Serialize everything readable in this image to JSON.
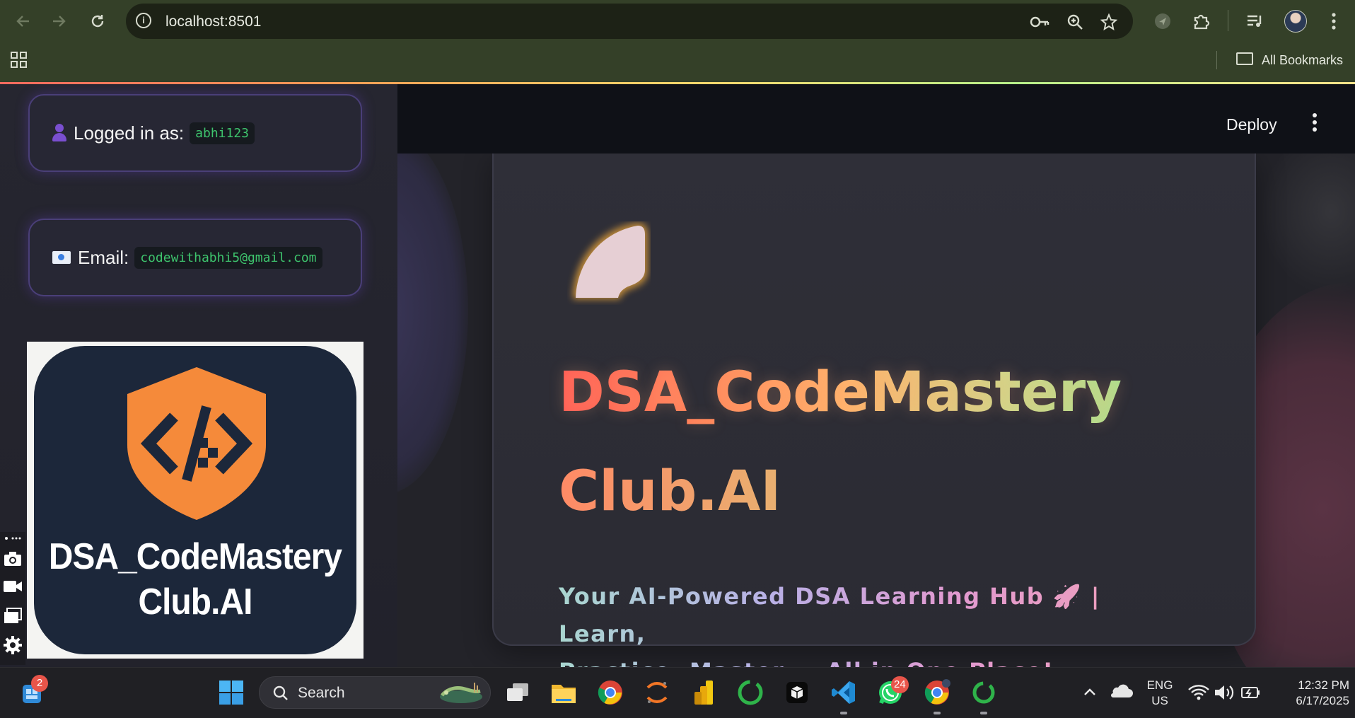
{
  "browser": {
    "url": "localhost:8501",
    "bookmarks_label": "All Bookmarks",
    "accent": "#ff6a5f"
  },
  "sidebar": {
    "logged_in_label": "Logged in as:",
    "username": "abhi123",
    "email_label": "Email:",
    "email": "codewithabhi5@gmail.com",
    "logo_line1": "DSA_CodeMastery",
    "logo_line2": "Club.AI",
    "logo_color": "#f58a3a"
  },
  "header": {
    "deploy_label": "Deploy"
  },
  "hero": {
    "title_line1": "DSA_CodeMastery",
    "title_line2": "Club.AI",
    "subtitle_line1": "Your AI-Powered DSA Learning Hub 🚀 | Learn,",
    "subtitle_line2": "Practice, Master — All in One Place!"
  },
  "taskbar": {
    "search_label": "Search",
    "widgets_badge": "2",
    "whatsapp_badge": "24",
    "lang_line1": "ENG",
    "lang_line2": "US",
    "time": "12:32 PM",
    "date": "6/17/2025"
  }
}
